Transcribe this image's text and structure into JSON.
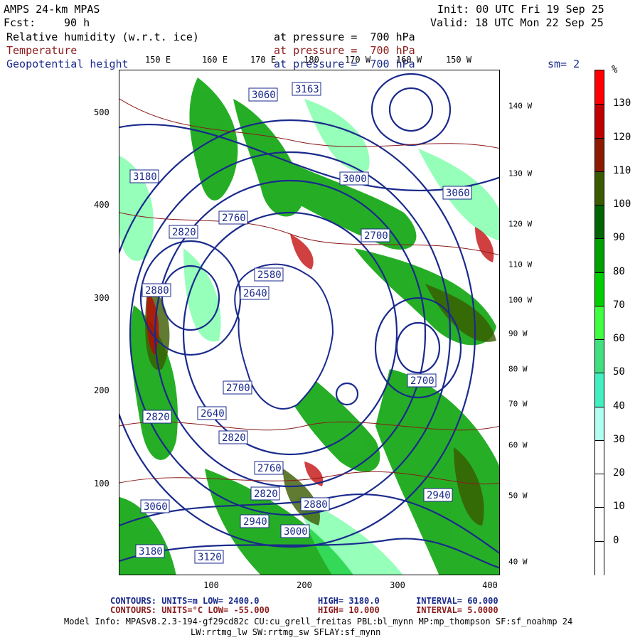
{
  "header": {
    "model": "AMPS 24-km MPAS",
    "fcst_label": "Fcst:",
    "fcst_value": "90 h",
    "init": "Init: 00 UTC Fri 19 Sep 25",
    "valid": "Valid: 18 UTC Mon 22 Sep 25",
    "field1_name": "Relative humidity (w.r.t. ice)",
    "field1_level": "at pressure =  700 hPa",
    "field2_name": "Temperature",
    "field2_level": "at pressure =  700 hPa",
    "field3_name": "Geopotential height",
    "field3_level": "at pressure =  700 hPa",
    "smoothing": "sm= 2"
  },
  "axes": {
    "x_ticks": [
      "100",
      "200",
      "300",
      "400"
    ],
    "y_ticks": [
      "500",
      "400",
      "300",
      "200",
      "100"
    ],
    "lon_top": [
      "150 E",
      "160 E",
      "170 E",
      "180",
      "170 W",
      "160 W",
      "150 W"
    ],
    "lon_right": [
      "140 W",
      "130 W",
      "120 W",
      "110 W",
      "100 W",
      "90 W",
      "80 W",
      "70 W",
      "60 W",
      "50 W",
      "40 W"
    ]
  },
  "colorbar": {
    "unit": "%",
    "labels": [
      "130",
      "120",
      "110",
      "100",
      "90",
      "80",
      "70",
      "60",
      "50",
      "40",
      "30",
      "20",
      "10",
      "0"
    ],
    "colors": [
      "#ff0000",
      "#c00000",
      "#8b1a00",
      "#3a5a00",
      "#006400",
      "#00a000",
      "#00d000",
      "#40ff40",
      "#40e080",
      "#40f0c0",
      "#b0fff0",
      "#ffffff",
      "#ffffff",
      "#ffffff",
      "#ffffff"
    ]
  },
  "contour_labels": [
    "3060",
    "3163",
    "3120",
    "2880",
    "2820",
    "2760",
    "2700",
    "2640",
    "2580",
    "3000",
    "2940",
    "3180"
  ],
  "footer": {
    "line1_a": "CONTOURS:  UNITS=m  LOW=  2400.0",
    "line1_b": "HIGH=  3180.0",
    "line1_c": "INTERVAL=   60.000",
    "line2_a": "CONTOURS:  UNITS=°C  LOW=  -55.000",
    "line2_b": "HIGH=  10.000",
    "line2_c": "INTERVAL=   5.0000",
    "line3": "Model Info: MPASv8.2.3-194-gf29cd82c CU:cu_grell_freitas PBL:bl_mynn MP:mp_thompson SF:sf_noahmp 24",
    "line4": "LW:rrtmg_lw SW:rrtmg_sw SFLAY:sf_mynn"
  }
}
